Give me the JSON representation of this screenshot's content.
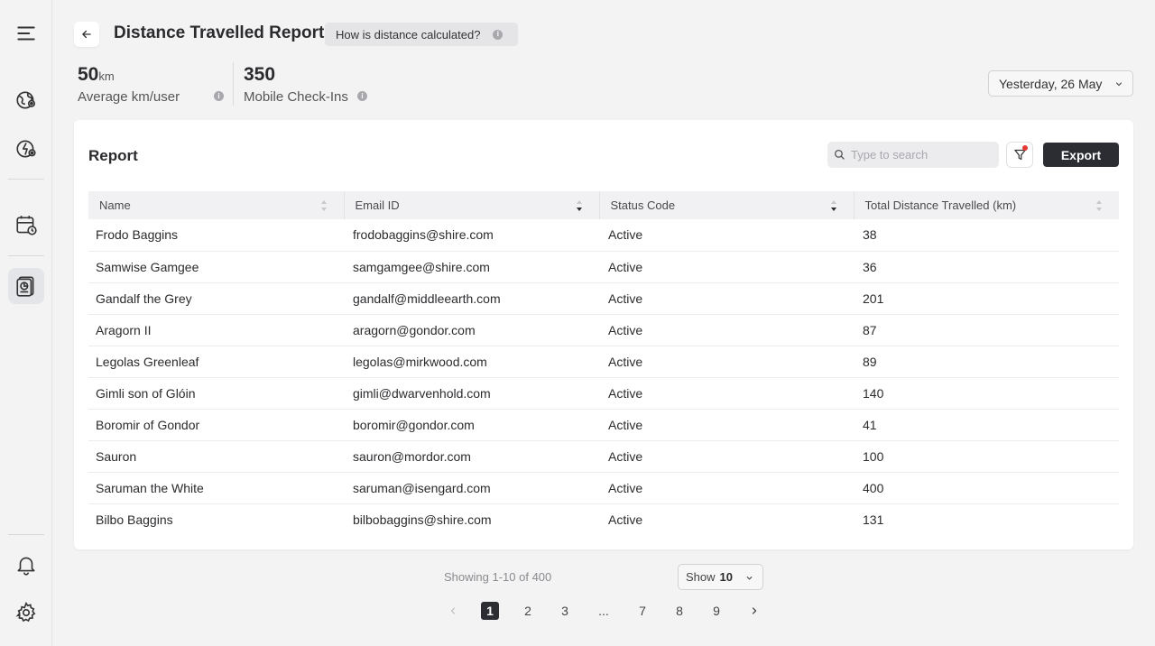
{
  "header": {
    "title": "Distance Travelled Report",
    "help_label": "How is distance calculated?"
  },
  "stats": [
    {
      "value": "50",
      "unit": "km",
      "label": "Average km/user"
    },
    {
      "value": "350",
      "unit": "",
      "label": "Mobile Check-Ins"
    }
  ],
  "date_filter": {
    "selected": "Yesterday, 26 May"
  },
  "report": {
    "title": "Report",
    "search_placeholder": "Type to search",
    "export_label": "Export",
    "columns": [
      "Name",
      "Email ID",
      "Status Code",
      "Total Distance Travelled (km)"
    ],
    "rows": [
      [
        "Frodo Baggins",
        "frodobaggins@shire.com",
        "Active",
        "38"
      ],
      [
        "Samwise Gamgee",
        "samgamgee@shire.com",
        "Active",
        "36"
      ],
      [
        "Gandalf the Grey",
        "gandalf@middleearth.com",
        "Active",
        "201"
      ],
      [
        "Aragorn II",
        "aragorn@gondor.com",
        "Active",
        "87"
      ],
      [
        "Legolas Greenleaf",
        "legolas@mirkwood.com",
        "Active",
        "89"
      ],
      [
        "Gimli son of Glóin",
        "gimli@dwarvenhold.com",
        "Active",
        "140"
      ],
      [
        "Boromir of Gondor",
        "boromir@gondor.com",
        "Active",
        "41"
      ],
      [
        "Sauron",
        "sauron@mordor.com",
        "Active",
        "100"
      ],
      [
        "Saruman the White",
        "saruman@isengard.com",
        "Active",
        "400"
      ],
      [
        "Bilbo Baggins",
        "bilbobaggins@shire.com",
        "Active",
        "131"
      ]
    ]
  },
  "pagination": {
    "showing": "Showing 1-10 of 400",
    "show_label": "Show",
    "page_size": "10",
    "pages": [
      "1",
      "2",
      "3",
      "...",
      "7",
      "8",
      "9"
    ],
    "current_page": "1"
  },
  "colors": {
    "accent_dark": "#2b2d33",
    "filter_dot": "#e53935",
    "background": "#f3f3f4"
  }
}
